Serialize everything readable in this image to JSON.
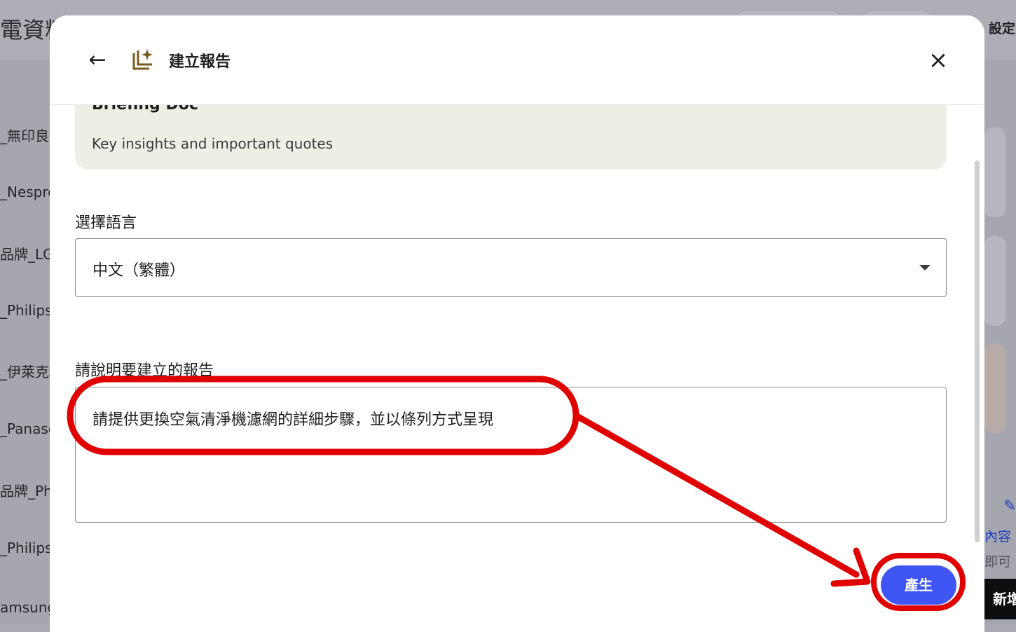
{
  "background": {
    "title": "電資料",
    "settings_label": "設定",
    "list_items": [
      "_無印良品",
      "_Nespresso",
      "品牌_LG",
      "_Philips",
      "_伊萊克斯",
      "_Panasonic",
      "品牌_Philips",
      "_Philips_",
      "amsung"
    ],
    "side_link": "內容",
    "side_text": "即可",
    "new_button": "新增"
  },
  "dialog": {
    "title": "建立報告",
    "back_icon": "arrow-left-icon",
    "report_icon": "report-sparkle-icon",
    "close_icon": "close-icon",
    "summary_card": {
      "title": "Briefing Doc",
      "description": "Key insights and important quotes"
    },
    "language_section": {
      "label": "選擇語言",
      "selected": "中文（繁體）"
    },
    "description_section": {
      "label": "請說明要建立的報告",
      "value": "請提供更換空氣清淨機濾網的詳細步驟，並以條列方式呈現"
    },
    "generate_label": "產生"
  },
  "colors": {
    "accent": "#3f56f5",
    "annotation": "#e00000",
    "card_bg": "#efeee6",
    "icon_brown": "#7a5a1e"
  }
}
